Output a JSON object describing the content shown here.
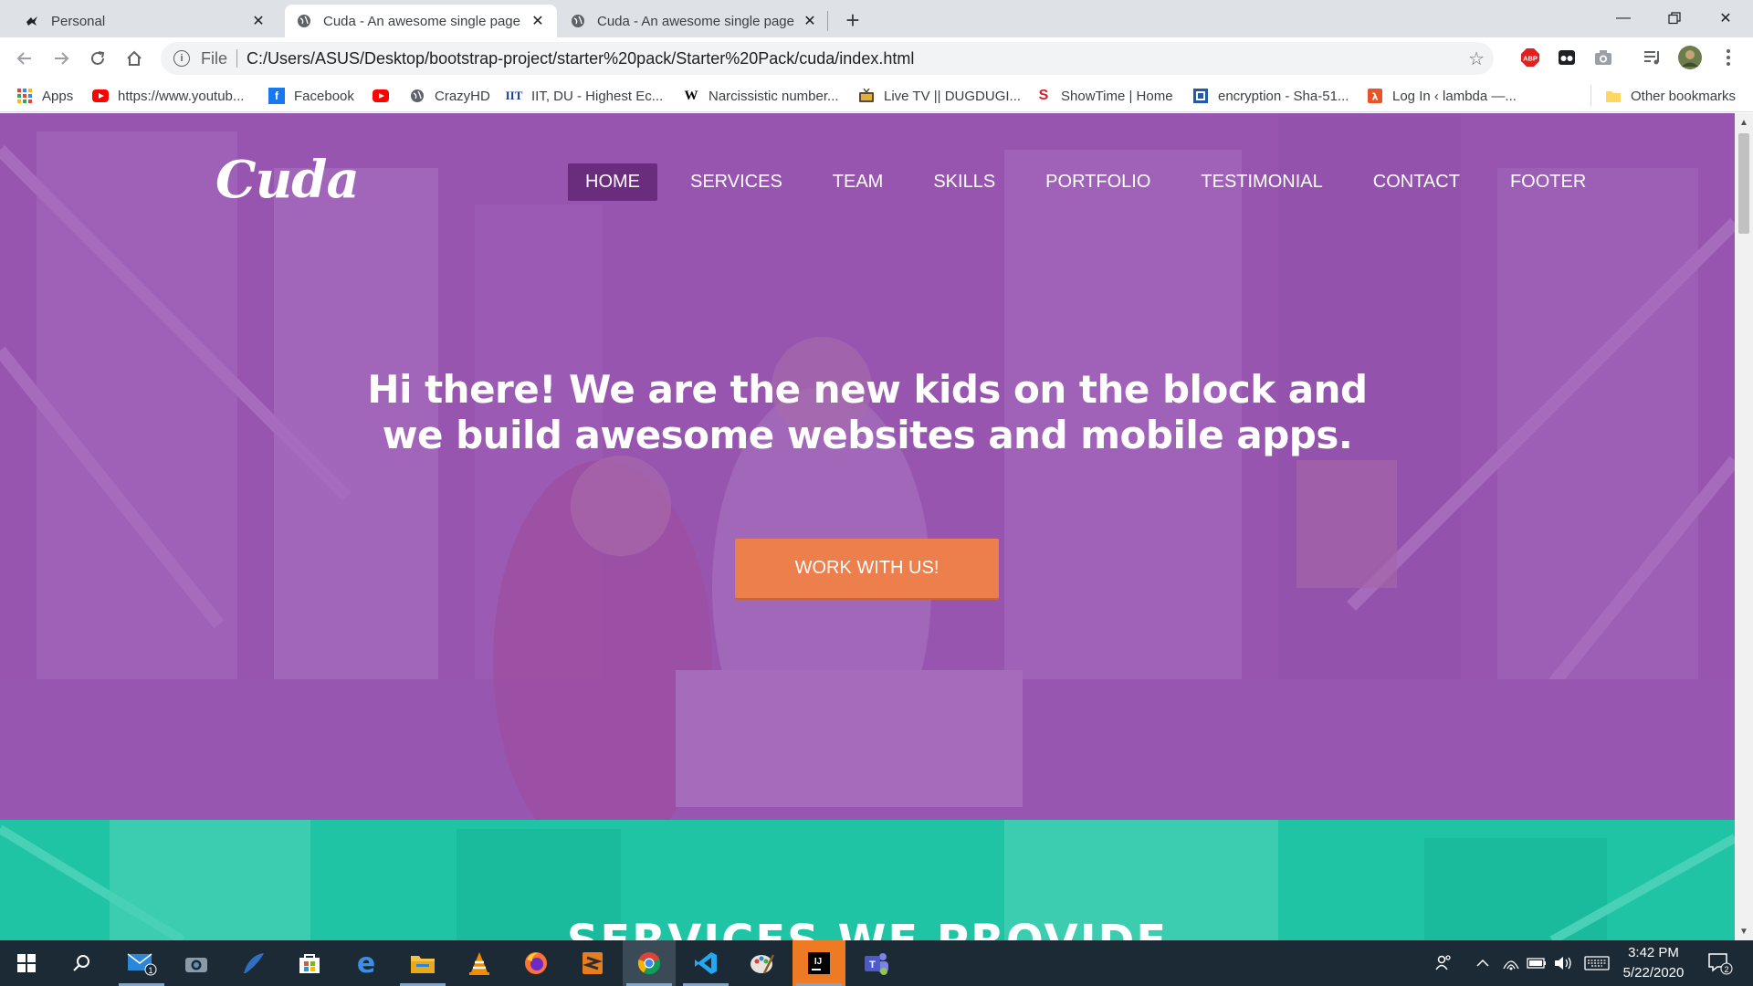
{
  "browser": {
    "tabs": [
      {
        "title": "Personal",
        "icon": "bird-icon",
        "active": false
      },
      {
        "title": "Cuda - An awesome single page",
        "icon": "globe-icon",
        "active": true
      },
      {
        "title": "Cuda - An awesome single page",
        "icon": "globe-icon",
        "active": false
      }
    ],
    "address": {
      "scheme_label": "File",
      "url": "C:/Users/ASUS/Desktop/bootstrap-project/starter%20pack/Starter%20Pack/cuda/index.html"
    },
    "extensions": [
      {
        "name": "adblock-icon",
        "label": "ABP"
      },
      {
        "name": "glasses-extension-icon"
      },
      {
        "name": "camera-extension-icon"
      },
      {
        "name": "media-playlist-icon"
      },
      {
        "name": "profile-avatar"
      },
      {
        "name": "menu-kebab-icon"
      }
    ],
    "bookmarks": [
      {
        "label": "Apps",
        "icon": "apps-grid-icon"
      },
      {
        "label": "https://www.youtub...",
        "icon": "youtube-icon"
      },
      {
        "label": "Facebook",
        "icon": "facebook-icon"
      },
      {
        "label": "",
        "icon": "youtube-icon"
      },
      {
        "label": "CrazyHD",
        "icon": "globe-icon"
      },
      {
        "label": "IIT, DU - Highest Ec...",
        "icon": "iit-icon"
      },
      {
        "label": "Narcissistic number...",
        "icon": "wikipedia-icon"
      },
      {
        "label": "Live TV || DUGDUGI...",
        "icon": "tv-icon"
      },
      {
        "label": "ShowTime | Home",
        "icon": "showtime-icon"
      },
      {
        "label": "encryption - Sha-51...",
        "icon": "stackexchange-icon"
      },
      {
        "label": "Log In ‹ lambda —...",
        "icon": "lambda-icon"
      }
    ],
    "other_bookmarks": "Other bookmarks"
  },
  "page": {
    "logo": "Cuda",
    "nav": [
      "HOME",
      "SERVICES",
      "TEAM",
      "SKILLS",
      "PORTFOLIO",
      "TESTIMONIAL",
      "CONTACT",
      "FOOTER"
    ],
    "active_nav": "HOME",
    "headline_line1": "Hi there! We are the new kids on the block and",
    "headline_line2": "we build awesome websites and mobile apps.",
    "cta": "WORK WITH US!",
    "services_heading": "SERVICES WE PROVIDE",
    "colors": {
      "hero_purple": "#9b59b6",
      "nav_active": "#6a2c7d",
      "cta_orange": "#ec7f4b",
      "services_teal": "#1fc4a5"
    }
  },
  "taskbar": {
    "apps": [
      "start-icon",
      "search-icon",
      "mail-icon",
      "camera-icon",
      "sharepoint-icon",
      "store-icon",
      "edge-icon",
      "file-explorer-icon",
      "vlc-icon",
      "firefox-icon",
      "sublime-icon",
      "chrome-icon",
      "vscode-icon",
      "paint-icon",
      "intellij-icon",
      "teams-icon"
    ],
    "mail_badge": "1",
    "time": "3:42 PM",
    "date": "5/22/2020",
    "notification_count": "2"
  }
}
